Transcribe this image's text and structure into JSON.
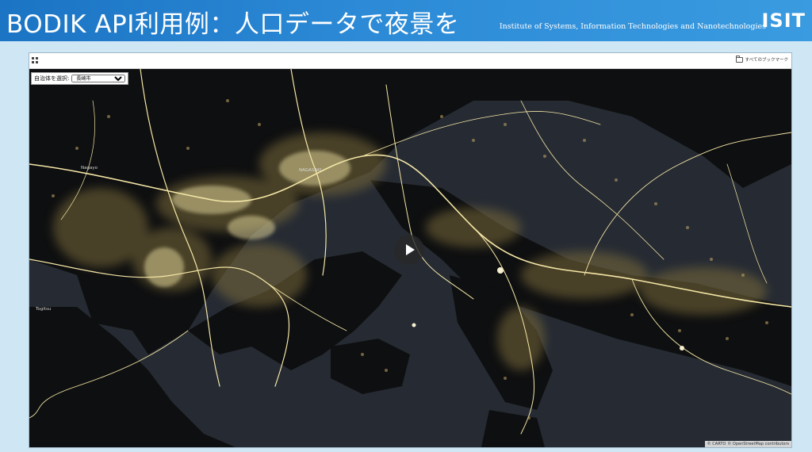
{
  "slide": {
    "title": "BODIK API利用例：人口データで夜景を",
    "subtitle": "Institute of Systems, Information Technologies and Nanotechnologies",
    "logo": "ISIT"
  },
  "app": {
    "bookmarks_label": "すべてのブックマーク"
  },
  "map": {
    "selector_label": "自治体を選択:",
    "selected_city": "長崎市",
    "city_labels": [
      "Nagayo",
      "NAGASAKI",
      "Togitsu"
    ],
    "attribution": [
      "© CARTO",
      "© OpenStreetMap contributors"
    ]
  },
  "colors": {
    "header": "#2c8ad6",
    "map_background": "#262b33",
    "road_glow": "#f4e6a6"
  }
}
